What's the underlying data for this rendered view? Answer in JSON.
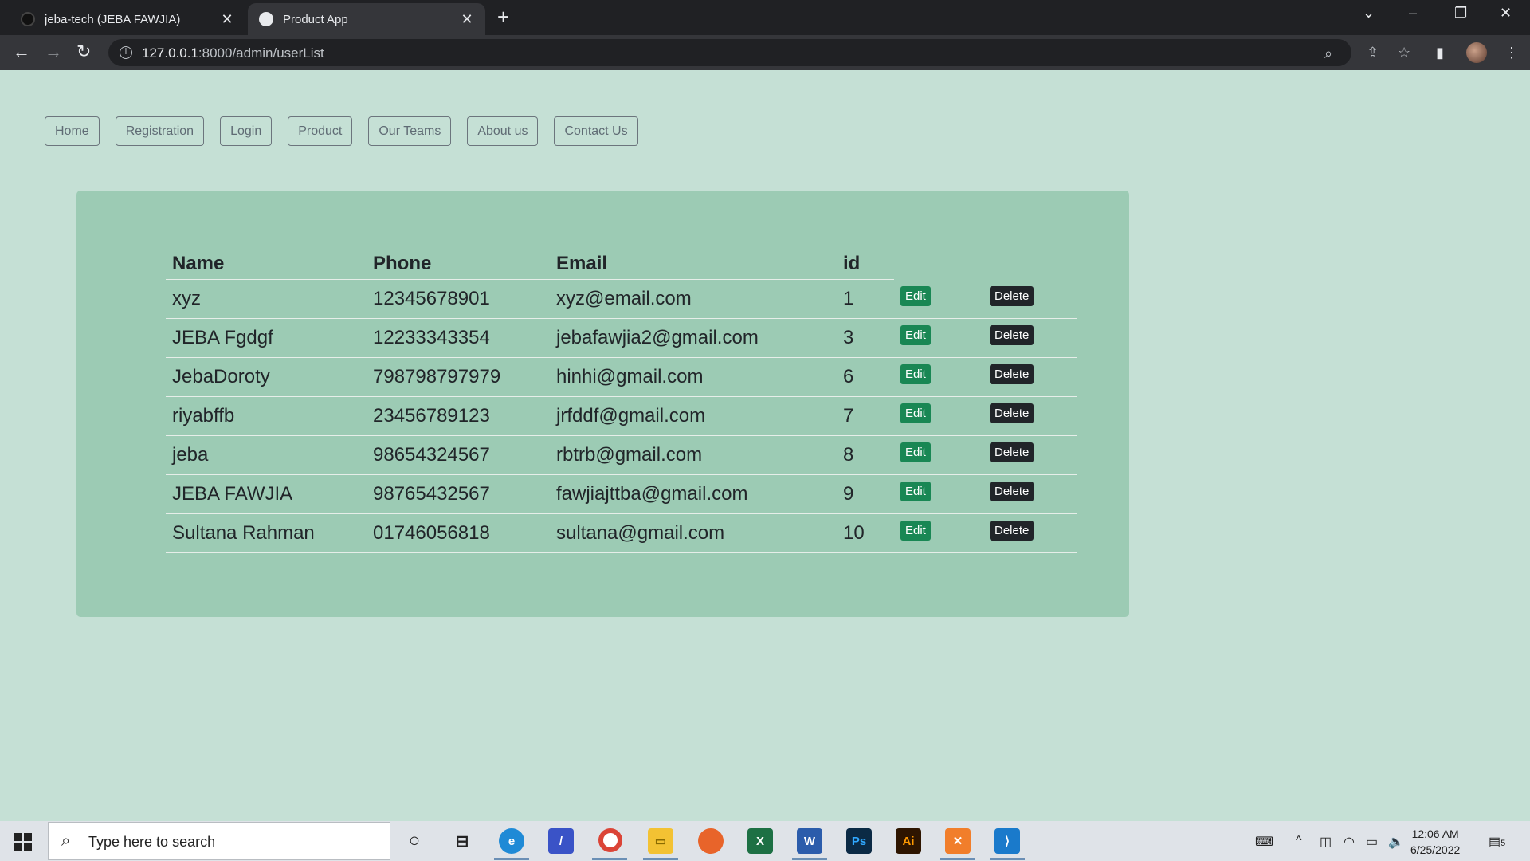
{
  "browser": {
    "tabs": [
      {
        "title": "jeba-tech (JEBA FAWJIA)",
        "active": false
      },
      {
        "title": "Product App",
        "active": true
      }
    ],
    "url_host": "127.0.0.1",
    "url_path": ":8000/admin/userList"
  },
  "nav": {
    "links": [
      "Home",
      "Registration",
      "Login",
      "Product",
      "Our Teams",
      "About us",
      "Contact Us"
    ]
  },
  "table": {
    "headers": {
      "name": "Name",
      "phone": "Phone",
      "email": "Email",
      "id": "id"
    },
    "edit_label": "Edit",
    "delete_label": "Delete",
    "rows": [
      {
        "name": "xyz",
        "phone": "12345678901",
        "email": "xyz@email.com",
        "id": "1"
      },
      {
        "name": "JEBA Fgdgf",
        "phone": "12233343354",
        "email": "jebafawjia2@gmail.com",
        "id": "3"
      },
      {
        "name": "JebaDoroty",
        "phone": "798798797979",
        "email": "hinhi@gmail.com",
        "id": "6"
      },
      {
        "name": "riyabffb",
        "phone": "23456789123",
        "email": "jrfddf@gmail.com",
        "id": "7"
      },
      {
        "name": "jeba",
        "phone": "98654324567",
        "email": "rbtrb@gmail.com",
        "id": "8"
      },
      {
        "name": "JEBA FAWJIA",
        "phone": "98765432567",
        "email": "fawjiajttba@gmail.com",
        "id": "9"
      },
      {
        "name": "Sultana Rahman",
        "phone": "01746056818",
        "email": "sultana@gmail.com",
        "id": "10"
      }
    ]
  },
  "taskbar": {
    "search_placeholder": "Type here to search",
    "time": "12:06 AM",
    "date": "6/25/2022",
    "notification_count": "5"
  },
  "colors": {
    "page_bg": "#c5e0d5",
    "card_bg": "#9ccbb4",
    "edit_btn": "#198754",
    "delete_btn": "#212529"
  }
}
